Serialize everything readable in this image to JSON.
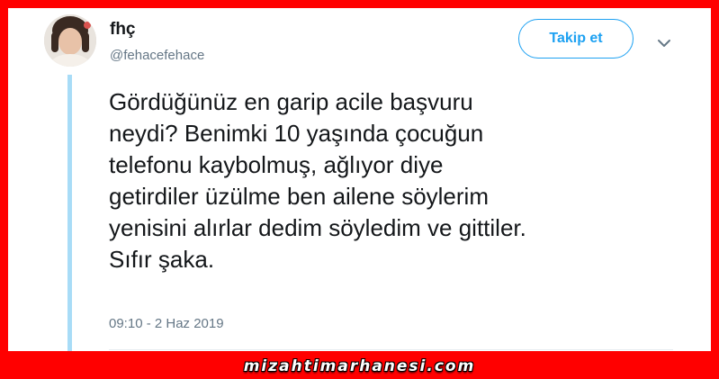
{
  "tweet": {
    "author": {
      "display_name": "fhç",
      "handle": "@fehacefehace"
    },
    "follow_label": "Takip et",
    "lines": [
      "Gördüğünüz en garip acile başvuru",
      "neydi? Benimki 10 yaşında çocuğun",
      "telefonu kaybolmuş, ağlıyor diye",
      "getirdiler üzülme ben ailene söylerim",
      "yenisini alırlar dedim söyledim ve gittiler.",
      "Sıfır şaka."
    ],
    "timestamp": "09:10 - 2 Haz 2019"
  },
  "icons": {
    "menu": "chevron-down-icon"
  },
  "watermark": "mizahtimarhanesi.com",
  "colors": {
    "border": "#ff0000",
    "accent": "#1da1f2",
    "thread_line": "#a8dcf7",
    "text": "#14171a",
    "muted": "#657786"
  }
}
